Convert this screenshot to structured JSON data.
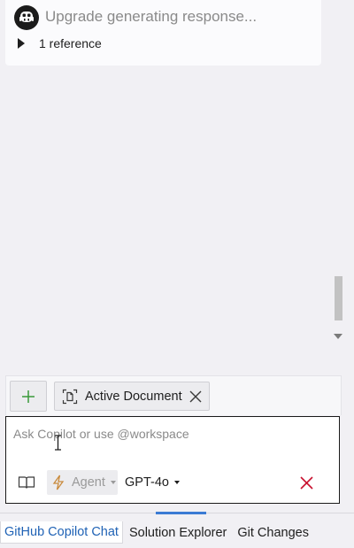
{
  "chat": {
    "status_text": "Upgrade generating response...",
    "reference_label": "1 reference"
  },
  "context": {
    "add_label": "+",
    "chip_label": "Active Document"
  },
  "input": {
    "placeholder": "Ask Copilot or use @workspace"
  },
  "toolbar": {
    "mode_label": "Agent",
    "model_label": "GPT-4o"
  },
  "tabs": [
    {
      "label": "GitHub Copilot Chat",
      "active": true
    },
    {
      "label": "Solution Explorer",
      "active": false
    },
    {
      "label": "Git Changes",
      "active": false
    }
  ],
  "icons": {
    "avatar": "copilot-icon",
    "expand": "triangle-right-icon",
    "add": "plus-icon",
    "chip": "document-scope-icon",
    "chip_close": "close-icon",
    "book": "book-icon",
    "mode": "lightning-bolt-icon",
    "cancel": "cancel-icon"
  },
  "colors": {
    "accent_green": "#3a9a3a",
    "cancel_red": "#c8102e",
    "bolt_orange": "#c98a3c",
    "active_tab_text": "#1f62b5",
    "active_indicator": "#3b7bd4"
  }
}
